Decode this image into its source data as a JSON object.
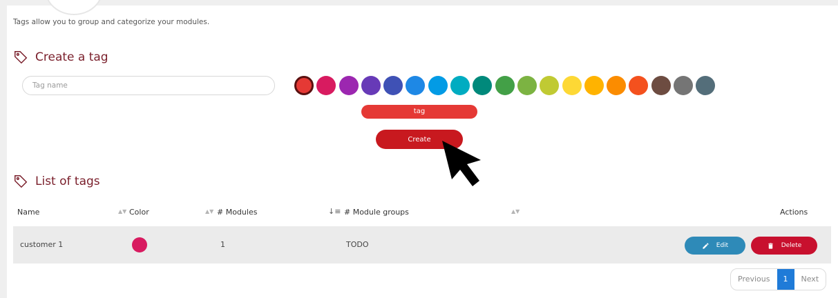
{
  "description": "Tags allow you to group and categorize your modules.",
  "create_section": {
    "title": "Create a tag",
    "input_placeholder": "Tag name",
    "input_value": "",
    "colors": [
      "#e53935",
      "#d81b60",
      "#9c27b0",
      "#673ab7",
      "#3f51b5",
      "#1e88e5",
      "#039be5",
      "#00acc1",
      "#00897b",
      "#43a047",
      "#7cb342",
      "#c0ca33",
      "#fdd835",
      "#ffb300",
      "#fb8c00",
      "#f4511e",
      "#6d4c41",
      "#757575",
      "#546e7a"
    ],
    "selected_color": "#e53935",
    "preview_label": "tag",
    "create_label": "Create"
  },
  "list_section": {
    "title": "List of tags",
    "columns": [
      "Name",
      "Color",
      "# Modules",
      "# Module groups",
      "Actions"
    ],
    "rows": [
      {
        "name": "customer 1",
        "color": "#d81b60",
        "modules": "1",
        "module_groups": "TODO",
        "edit_label": "Edit",
        "delete_label": "Delete"
      }
    ]
  },
  "pagination": {
    "previous": "Previous",
    "current": "1",
    "next": "Next"
  },
  "theme": {
    "edit_color": "#2e8ab8",
    "delete_color": "#c8102e",
    "accent": "#1f7bd8"
  }
}
